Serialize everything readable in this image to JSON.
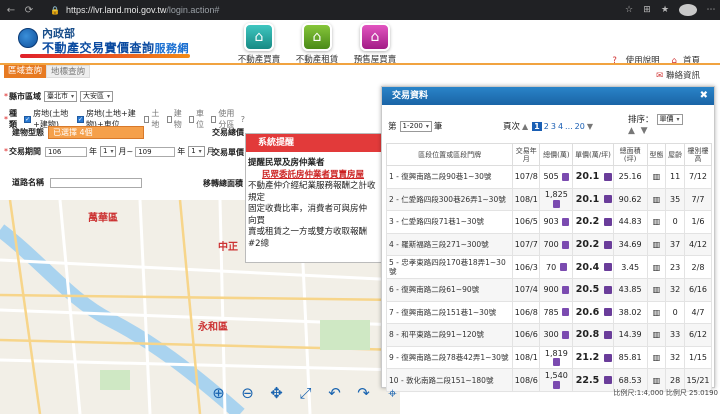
{
  "browser": {
    "url_host": "https://lvr.land.moi.gov.tw",
    "url_path": "/login.action#"
  },
  "header": {
    "ministry": "內政部",
    "site_title": "不動產交易實價查詢",
    "site_title_suffix": "服務網",
    "nav": [
      {
        "label": "不動產買賣",
        "icon": "house-icon"
      },
      {
        "label": "不動產租賃",
        "icon": "house-rent-icon"
      },
      {
        "label": "預售屋買賣",
        "icon": "presale-house-icon"
      }
    ],
    "links": {
      "help": "使用說明",
      "home": "首頁",
      "contact": "聯絡資訊"
    }
  },
  "tabs": {
    "district_query": "區域查詢",
    "landmark_query": "地標查詢"
  },
  "form": {
    "county_label": "縣市區域",
    "county_value": "臺北市",
    "district_value": "大安區",
    "type_label": "種類",
    "type_options": [
      "房地(土地+建物)",
      "房地(土地+建物)+車位",
      "土地",
      "建物",
      "車位"
    ],
    "zone_label": "使用分區",
    "building_type_label": "建物型態",
    "building_type_value": "已選擇 4個",
    "period_label": "交易期間",
    "period_start_year": "106",
    "period_start_month": "1",
    "period_end_year": "109",
    "period_end_month": "1",
    "year_unit": "年",
    "month_unit": "月~",
    "month_unit_end": "月",
    "road_label": "道路名稱",
    "total_price_label": "交易總價",
    "unit_price_label": "交易單價",
    "move_label": "移轉總面積"
  },
  "notice": {
    "title": "系統提醒",
    "heading": "提醒民眾及房仲業者",
    "red_line": "民眾委託房仲業者買賣房屋",
    "body_lines": [
      "不動產仲介經紀業服務報酬之計收",
      "規定",
      "固定收費比率，消費者可與房仲",
      "向買",
      "賣或租賃之一方或雙方收取報酬",
      "#2總"
    ]
  },
  "map": {
    "labels": [
      "萬華區",
      "中正",
      "永和區"
    ]
  },
  "panel": {
    "title": "交易資料",
    "page_prefix": "第",
    "page_range": "1-200",
    "page_suffix": "筆",
    "page_label": "頁次",
    "pages": [
      "1",
      "2",
      "3",
      "4",
      "...",
      "20"
    ],
    "sort_label": "排序：",
    "sort_value": "單價",
    "columns": [
      "區段位置或區段門牌",
      "交易年月",
      "總價(萬)",
      "單價(萬/坪)",
      "總面積(坪)",
      "型態",
      "屋齡",
      "樓別樓高"
    ],
    "rows": [
      {
        "no": "1",
        "addr": "- 復興南路二段90巷1~30號",
        "date": "107/8",
        "total": "505",
        "unit": "20.1",
        "area": "25.16",
        "type": "11",
        "age": "7/12"
      },
      {
        "no": "2",
        "addr": "- 仁愛路四段300巷26弄1~30號",
        "date": "108/1",
        "total": "1,825",
        "unit": "20.1",
        "area": "90.62",
        "type": "35",
        "age": "7/7"
      },
      {
        "no": "3",
        "addr": "- 仁愛路四段71巷1~30號",
        "date": "106/5",
        "total": "903",
        "unit": "20.2",
        "area": "44.83",
        "type": "0",
        "age": "1/6"
      },
      {
        "no": "4",
        "addr": "- 羅斯福路三段271~300號",
        "date": "107/7",
        "total": "700",
        "unit": "20.2",
        "area": "34.69",
        "type": "37",
        "age": "4/12"
      },
      {
        "no": "5",
        "addr": "- 忠孝東路四段170巷18弄1~30號",
        "date": "106/3",
        "total": "70",
        "unit": "20.4",
        "area": "3.45",
        "type": "23",
        "age": "2/8"
      },
      {
        "no": "6",
        "addr": "- 復興南路二段61~90號",
        "date": "107/4",
        "total": "900",
        "unit": "20.5",
        "area": "43.85",
        "type": "32",
        "age": "6/16"
      },
      {
        "no": "7",
        "addr": "- 復興南路二段151巷1~30號",
        "date": "106/8",
        "total": "785",
        "unit": "20.6",
        "area": "38.02",
        "type": "0",
        "age": "4/7"
      },
      {
        "no": "8",
        "addr": "- 和平東路二段91~120號",
        "date": "106/6",
        "total": "300",
        "unit": "20.8",
        "area": "14.39",
        "type": "33",
        "age": "6/12"
      },
      {
        "no": "9",
        "addr": "- 復興南路二段78巷42弄1~30號",
        "date": "108/1",
        "total": "1,819",
        "unit": "21.2",
        "area": "85.81",
        "type": "32",
        "age": "1/15"
      },
      {
        "no": "10",
        "addr": "- 敦化南路二段151~180號",
        "date": "108/6",
        "total": "1,540",
        "unit": "22.5",
        "area": "68.53",
        "type": "28",
        "age": "15/21"
      }
    ]
  },
  "scale_text": "比例尺:1:4,000 比例尺 25.0190"
}
